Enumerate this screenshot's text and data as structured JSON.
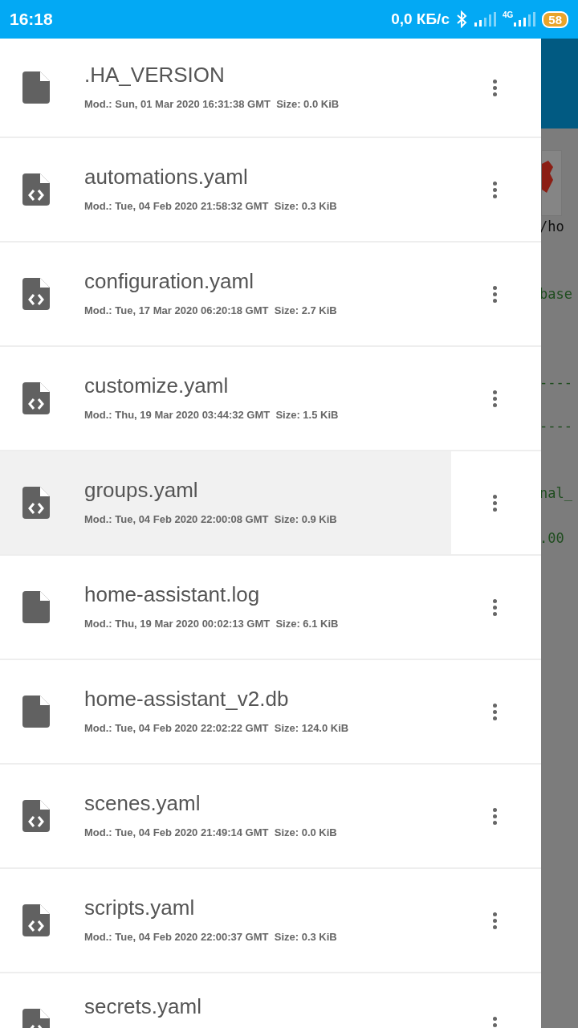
{
  "status_bar": {
    "time": "16:18",
    "speed": "0,0 КБ/с",
    "network": "4G",
    "battery": "58"
  },
  "files": [
    {
      "name": ".HA_VERSION",
      "meta": "Mod.: Sun, 01 Mar 2020 16:31:38 GMT  Size: 0.0 KiB",
      "kind": "file",
      "highlighted": false
    },
    {
      "name": "automations.yaml",
      "meta": "Mod.: Tue, 04 Feb 2020 21:58:32 GMT  Size: 0.3 KiB",
      "kind": "code",
      "highlighted": false
    },
    {
      "name": "configuration.yaml",
      "meta": "Mod.: Tue, 17 Mar 2020 06:20:18 GMT  Size: 2.7 KiB",
      "kind": "code",
      "highlighted": false
    },
    {
      "name": "customize.yaml",
      "meta": "Mod.: Thu, 19 Mar 2020 03:44:32 GMT  Size: 1.5 KiB",
      "kind": "code",
      "highlighted": false
    },
    {
      "name": "groups.yaml",
      "meta": "Mod.: Tue, 04 Feb 2020 22:00:08 GMT  Size: 0.9 KiB",
      "kind": "code",
      "highlighted": true
    },
    {
      "name": "home-assistant.log",
      "meta": "Mod.: Thu, 19 Mar 2020 00:02:13 GMT  Size: 6.1 KiB",
      "kind": "file",
      "highlighted": false
    },
    {
      "name": "home-assistant_v2.db",
      "meta": "Mod.: Tue, 04 Feb 2020 22:02:22 GMT  Size: 124.0 KiB",
      "kind": "file",
      "highlighted": false
    },
    {
      "name": "scenes.yaml",
      "meta": "Mod.: Tue, 04 Feb 2020 21:49:14 GMT  Size: 0.0 KiB",
      "kind": "code",
      "highlighted": false
    },
    {
      "name": "scripts.yaml",
      "meta": "Mod.: Tue, 04 Feb 2020 22:00:37 GMT  Size: 0.3 KiB",
      "kind": "code",
      "highlighted": false
    },
    {
      "name": "secrets.yaml",
      "kind": "code",
      "highlighted": false
    }
  ],
  "background_code": [
    {
      "text": "/ho",
      "kind": "path"
    },
    {
      "text": "base",
      "kind": "key"
    },
    {
      "text": "----",
      "kind": "key"
    },
    {
      "text": "----",
      "kind": "key"
    },
    {
      "text": "nal_",
      "kind": "key"
    },
    {
      "text": ".00",
      "kind": "key"
    }
  ]
}
